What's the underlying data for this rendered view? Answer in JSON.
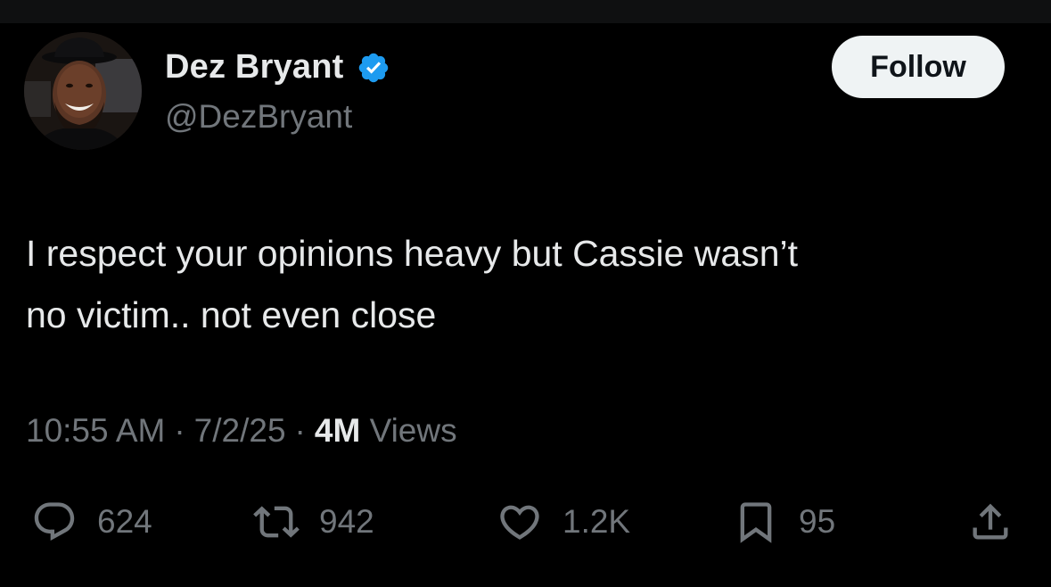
{
  "author": {
    "display_name": "Dez Bryant",
    "handle": "@DezBryant",
    "verified": true
  },
  "follow_button": {
    "label": "Follow"
  },
  "tweet": {
    "text_line1": "I respect your opinions heavy but Cassie wasn’t",
    "text_line2": "no victim.. not even close",
    "time": "10:55 AM",
    "date": "7/2/25",
    "separator": "·",
    "views_count": "4M",
    "views_label": "Views"
  },
  "actions": {
    "replies": "624",
    "reposts": "942",
    "likes": "1.2K",
    "bookmarks": "95"
  },
  "icons": {
    "verified": "verified-badge-icon",
    "reply": "reply-icon",
    "repost": "repost-icon",
    "like": "heart-icon",
    "bookmark": "bookmark-icon",
    "share": "share-icon"
  },
  "colors": {
    "background": "#000000",
    "primary_text": "#e7e9ea",
    "secondary_text": "#71767b",
    "verified_blue": "#1d9bf0",
    "button_bg": "#eff3f4"
  }
}
